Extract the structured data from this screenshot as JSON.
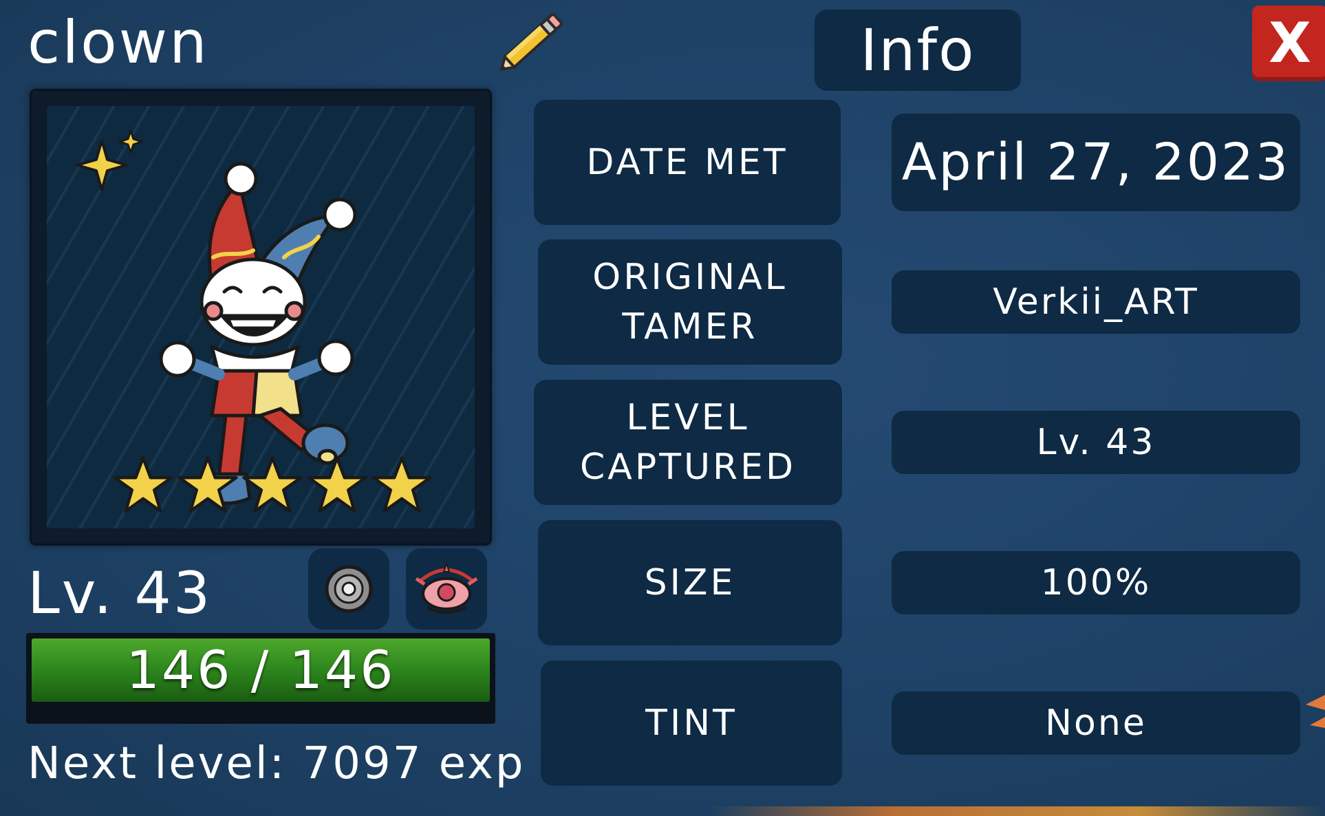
{
  "pet": {
    "name": "clown",
    "stars": 5,
    "level_label": "Lv. 43",
    "hp_text": "146 / 146",
    "hp_fraction": 1.0,
    "next_level_text": "Next level: 7097 exp"
  },
  "icons": {
    "rename": "pencil-icon",
    "disc": "disc-icon",
    "eye": "eye-icon",
    "sparkle": "sparkle-icon",
    "star": "star-icon"
  },
  "info_panel": {
    "title": "Info",
    "close_label": "X",
    "rows": [
      {
        "label": "DATE MET",
        "value": "April 27, 2023"
      },
      {
        "label": "ORIGINAL\nTAMER",
        "value": "Verkii_ART"
      },
      {
        "label": "LEVEL\nCAPTURED",
        "value": "Lv. 43"
      },
      {
        "label": "SIZE",
        "value": "100%"
      },
      {
        "label": "TINT",
        "value": "None"
      }
    ]
  },
  "colors": {
    "background": "#1e4266",
    "panel": "#0e2a44",
    "close_button": "#c2261f",
    "hp_green": "#2f8a1e",
    "star_yellow": "#f2d24a"
  }
}
